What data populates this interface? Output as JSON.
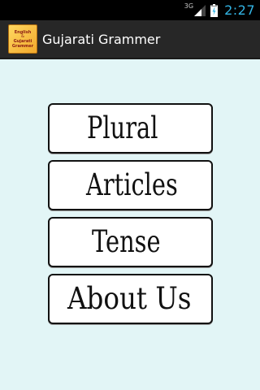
{
  "status_bar": {
    "network": "3G",
    "time": "2:27"
  },
  "action_bar": {
    "title": "Gujarati Grammer",
    "icon": {
      "name": "app-logo-icon",
      "lines": [
        "English",
        "&",
        "Gujarati",
        "Grammer"
      ]
    }
  },
  "menu": {
    "items": [
      {
        "label": "Plural"
      },
      {
        "label": "Articles"
      },
      {
        "label": "Tense"
      },
      {
        "label": "About Us"
      }
    ]
  },
  "colors": {
    "background": "#e2f5f6",
    "clock": "#33b5e5",
    "action_bar": "#272727"
  }
}
